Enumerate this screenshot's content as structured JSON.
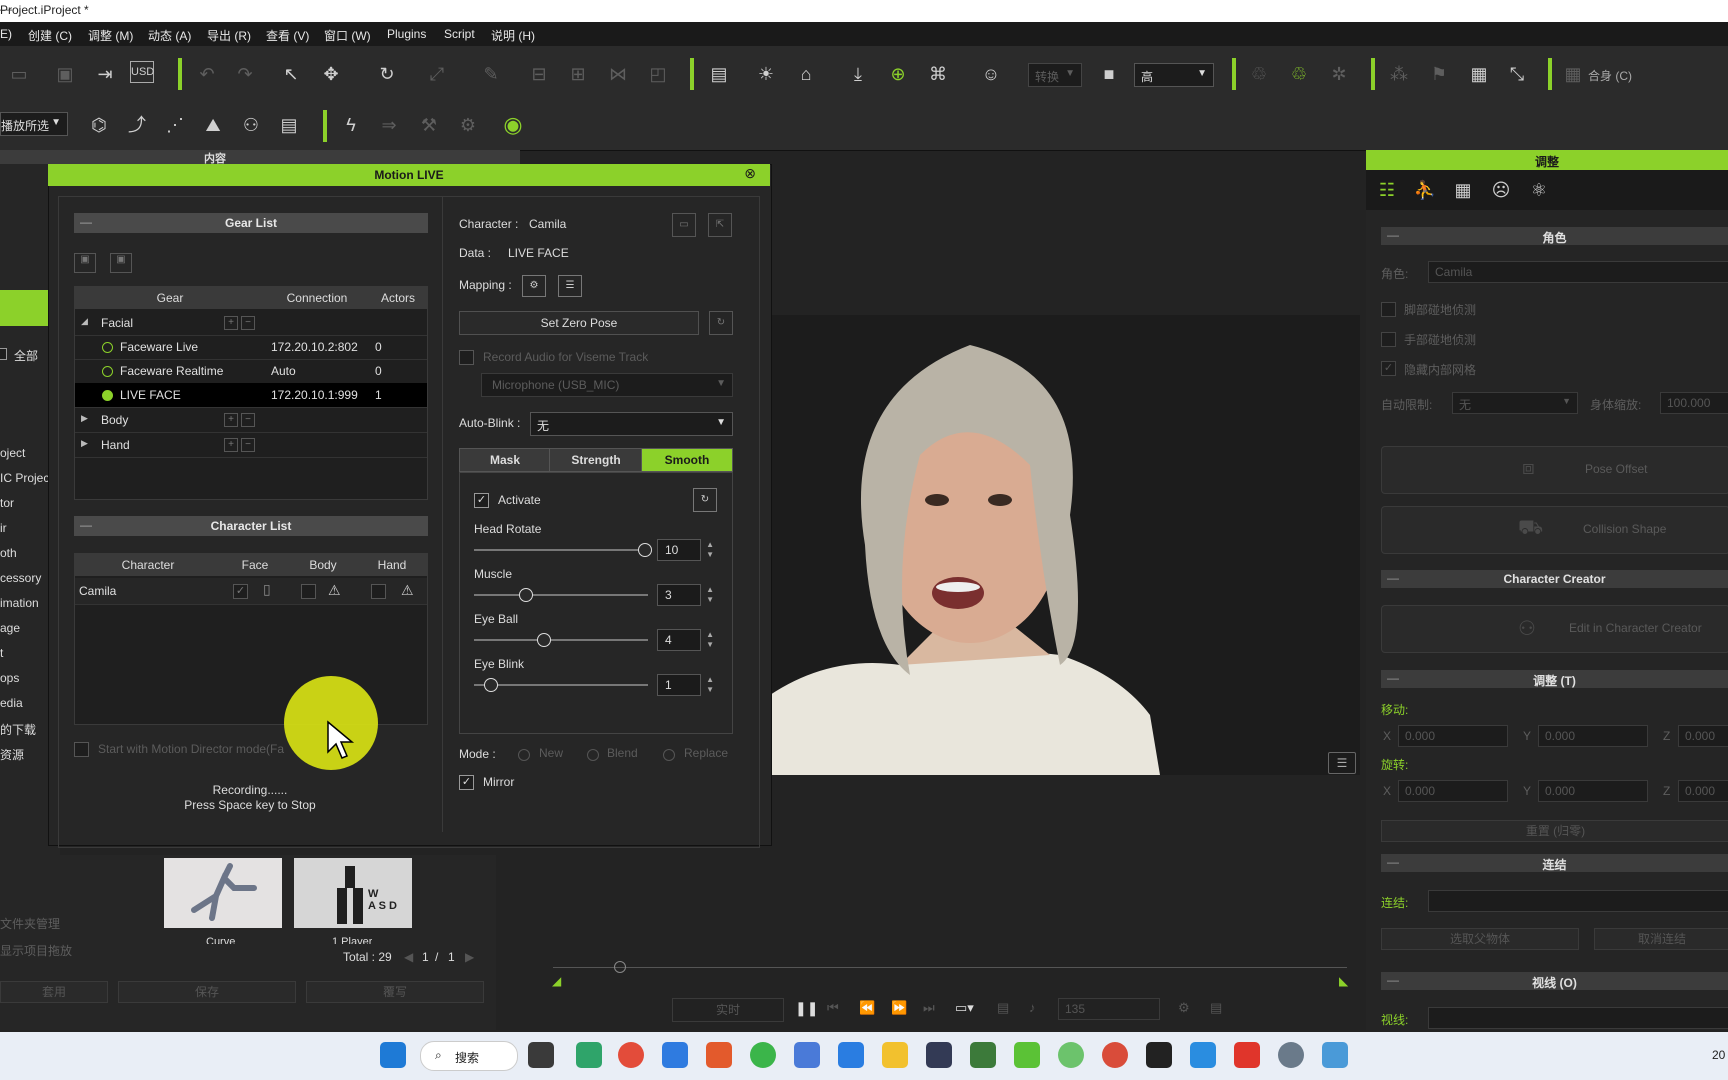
{
  "titlebar": {
    "title": "Project.iProject *",
    "controls": "—"
  },
  "menubar": {
    "items": [
      "E)",
      "创建 (C)",
      "调整 (M)",
      "动态 (A)",
      "导出 (R)",
      "查看 (V)",
      "窗口 (W)",
      "Plugins",
      "Script",
      "说明 (H)"
    ]
  },
  "toolbar": {
    "quality_label": "高",
    "fit_label": "合身 (C)",
    "preset_dim": "转换",
    "play_selected": "播放所选"
  },
  "content_panel": {
    "tab_title": "内容",
    "all_label": "全部",
    "list": [
      "oject",
      "IC Projec",
      "tor",
      "ir",
      "oth",
      "cessory",
      "imation",
      "age",
      "t",
      "ops",
      "edia",
      "的下载",
      "资源"
    ],
    "thumbs": [
      {
        "label": "Curve"
      },
      {
        "label": "1 Player",
        "overlay": "W\nA S D"
      }
    ],
    "total": "Total : 29",
    "page": "1",
    "page_sep": "/",
    "pages": "1",
    "left_dim_items": [
      "文件夹管理",
      "显示项目拖放"
    ],
    "buttons": [
      "套用",
      "保存",
      "覆写"
    ]
  },
  "motion_live": {
    "title": "Motion LIVE",
    "gear_list": {
      "title": "Gear List",
      "headers": [
        "Gear",
        "Connection",
        "Actors"
      ],
      "rows": [
        {
          "type": "group",
          "name": "Facial",
          "expanded": true
        },
        {
          "type": "device",
          "name": "Faceware Live",
          "connection": "172.20.10.2:802",
          "actors": "0",
          "active": false
        },
        {
          "type": "device",
          "name": "Faceware Realtime",
          "connection": "Auto",
          "actors": "0",
          "active": false
        },
        {
          "type": "device",
          "name": "LIVE FACE",
          "connection": "172.20.10.1:999",
          "actors": "1",
          "active": true,
          "selected": true
        },
        {
          "type": "group",
          "name": "Body",
          "expanded": false
        },
        {
          "type": "group",
          "name": "Hand",
          "expanded": false
        }
      ]
    },
    "character_list": {
      "title": "Character List",
      "headers": [
        "Character",
        "Face",
        "Body",
        "Hand"
      ],
      "rows": [
        {
          "name": "Camila"
        }
      ]
    },
    "start_md": "Start with Motion Director mode(Fa",
    "status_line1": "Recording......",
    "status_line2": "Press Space key to Stop",
    "character_label": "Character :",
    "character_value": "Camila",
    "data_label": "Data :",
    "data_value": "LIVE FACE",
    "mapping_label": "Mapping :",
    "set_zero_pose": "Set Zero Pose",
    "record_audio": "Record Audio for Viseme Track",
    "microphone": "Microphone (USB_MIC)",
    "auto_blink_label": "Auto-Blink :",
    "auto_blink_value": "无",
    "tabs": [
      "Mask",
      "Strength",
      "Smooth"
    ],
    "active_tab": "Smooth",
    "activate_label": "Activate",
    "sliders": [
      {
        "label": "Head Rotate",
        "value": "10",
        "fraction": 0.98
      },
      {
        "label": "Muscle",
        "value": "3",
        "fraction": 0.3
      },
      {
        "label": "Eye Ball",
        "value": "4",
        "fraction": 0.4
      },
      {
        "label": "Eye Blink",
        "value": "1",
        "fraction": 0.1
      }
    ],
    "mode_label": "Mode :",
    "modes": [
      "New",
      "Blend",
      "Replace"
    ],
    "mirror_label": "Mirror"
  },
  "right_panel": {
    "title": "调整",
    "role_section": "角色",
    "role_label": "角色:",
    "role_value": "Camila",
    "checks": [
      "脚部碰地侦测",
      "手部碰地侦测",
      "隐藏内部网格"
    ],
    "auto_lod_label": "自动限制:",
    "auto_lod_value": "无",
    "body_scale_label": "身体缩放:",
    "body_scale_value": "100.000",
    "pose_offset": "Pose Offset",
    "collision_shape": "Collision Shape",
    "cc_section": "Character Creator",
    "edit_cc": "Edit in Character Creator",
    "adjust_section": "调整 (T)",
    "move_label": "移动:",
    "rotate_label": "旋转:",
    "x": "X",
    "y": "Y",
    "z": "Z",
    "zero": "0.000",
    "reset": "重置 (归零)",
    "link_section": "连结",
    "link_label": "连结:",
    "pick_parent": "选取父物体",
    "unlink": "取消连结",
    "gaze_section": "视线 (O)",
    "gaze_label": "视线:"
  },
  "playback": {
    "realtime": "实时",
    "frame": "135"
  },
  "taskbar": {
    "search": "搜索",
    "clock": "20"
  },
  "colors": {
    "accent": "#8cd12a",
    "panel": "#262626",
    "dark": "#1c1c1c"
  }
}
